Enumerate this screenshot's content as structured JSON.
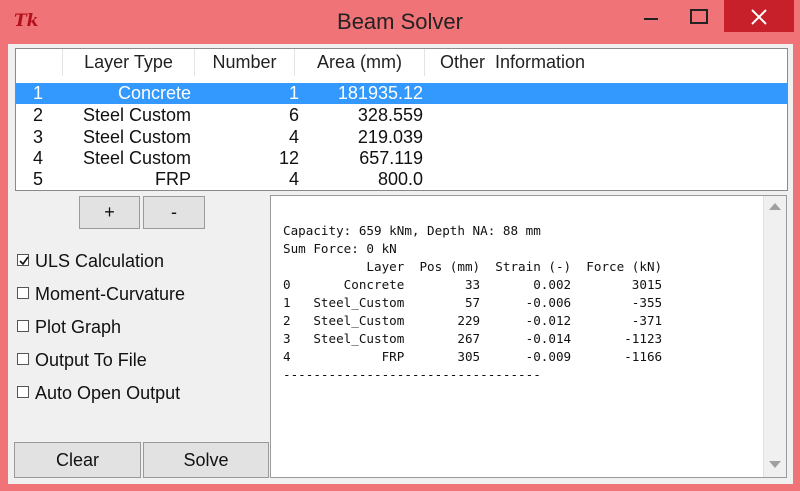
{
  "window": {
    "title": "Beam Solver",
    "icon": "tk-feather-icon"
  },
  "layer_list": {
    "columns": [
      "Layer Type",
      "Number",
      "Area (mm)",
      "Other  Information"
    ],
    "rows": [
      {
        "idx": "1",
        "type": "Concrete",
        "number": "1",
        "area": "181935.12",
        "selected": true
      },
      {
        "idx": "2",
        "type": "Steel Custom",
        "number": "6",
        "area": "328.559"
      },
      {
        "idx": "3",
        "type": "Steel Custom",
        "number": "4",
        "area": "219.039"
      },
      {
        "idx": "4",
        "type": "Steel Custom",
        "number": "12",
        "area": "657.119"
      },
      {
        "idx": "5",
        "type": "FRP",
        "number": "4",
        "area": "800.0"
      }
    ]
  },
  "buttons": {
    "add": "+",
    "remove": "-",
    "clear": "Clear",
    "solve": "Solve"
  },
  "options": [
    {
      "label": "ULS Calculation",
      "checked": true
    },
    {
      "label": "Moment-Curvature",
      "checked": false
    },
    {
      "label": "Plot Graph",
      "checked": false
    },
    {
      "label": "Output To File",
      "checked": false
    },
    {
      "label": "Auto Open Output",
      "checked": false
    }
  ],
  "output": {
    "lines": [
      "Capacity: 659 kNm, Depth NA: 88 mm",
      "Sum Force: 0 kN",
      "           Layer  Pos (mm)  Strain (-)  Force (kN)",
      "0       Concrete        33       0.002        3015",
      "1   Steel_Custom        57      -0.006        -355",
      "2   Steel_Custom       229      -0.012        -371",
      "3   Steel_Custom       267      -0.014       -1123",
      "4            FRP       305      -0.009       -1166",
      "----------------------------------"
    ]
  }
}
